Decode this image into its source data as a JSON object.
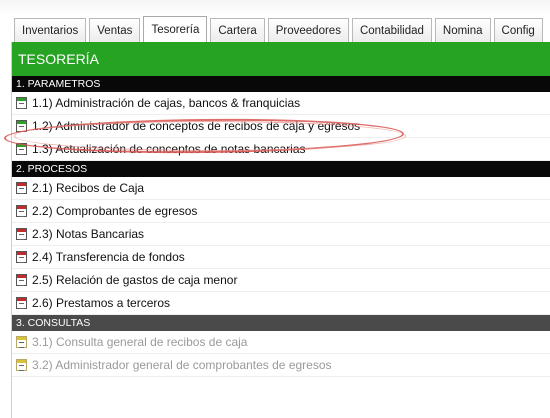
{
  "tabs": [
    {
      "label": "Inventarios",
      "active": false
    },
    {
      "label": "Ventas",
      "active": false
    },
    {
      "label": "Tesorería",
      "active": true
    },
    {
      "label": "Cartera",
      "active": false
    },
    {
      "label": "Proveedores",
      "active": false
    },
    {
      "label": "Contabilidad",
      "active": false
    },
    {
      "label": "Nomina",
      "active": false
    },
    {
      "label": "Config",
      "active": false
    }
  ],
  "title": "TESORERÍA",
  "sections": [
    {
      "header": "1. PARAMETROS",
      "items": [
        {
          "label": "1.1) Administración de cajas, bancos & franquicias",
          "icon": "green-form-icon"
        },
        {
          "label": "1.2) Administrador de conceptos de recibos de caja y egresos",
          "icon": "green-form-icon"
        },
        {
          "label": "1.3) Actualización de conceptos de notas bancarias",
          "icon": "green-form-icon"
        }
      ]
    },
    {
      "header": "2. PROCESOS",
      "items": [
        {
          "label": "2.1) Recibos de Caja",
          "icon": "red-form-icon"
        },
        {
          "label": "2.2) Comprobantes de egresos",
          "icon": "red-form-icon"
        },
        {
          "label": "2.3) Notas Bancarias",
          "icon": "red-form-icon"
        },
        {
          "label": "2.4) Transferencia de fondos",
          "icon": "red-form-icon"
        },
        {
          "label": "2.5) Relación de gastos de caja menor",
          "icon": "red-form-icon"
        },
        {
          "label": "2.6) Prestamos a terceros",
          "icon": "red-form-icon"
        }
      ]
    },
    {
      "header": "3. CONSULTAS",
      "items": [
        {
          "label": "3.1) Consulta general de recibos de caja",
          "icon": "yellow-form-icon"
        },
        {
          "label": "3.2) Administrador general de comprobantes de egresos",
          "icon": "yellow-form-icon"
        }
      ]
    }
  ],
  "colors": {
    "title_bg": "#27a323",
    "section_bg": "#080808",
    "consultas_bg": "#4a4a4a",
    "highlight": "#d9534f"
  }
}
